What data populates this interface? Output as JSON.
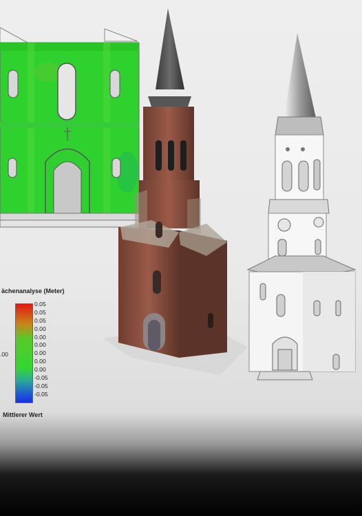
{
  "legend": {
    "title": "ächenanalyse (Meter)",
    "values": [
      "0.05",
      "0.05",
      "0.05",
      "0.00",
      "0.00",
      "0.00",
      "0.00",
      "0.00",
      "0.00",
      "-0.05",
      "-0.05",
      "-0.05"
    ],
    "side_label": ".00",
    "footer": "Mittlerer Wert"
  },
  "colors": {
    "deviation_high": "#e01a12",
    "deviation_zero": "#34d634",
    "deviation_low": "#1a2fe0",
    "brick": "#8a4e3e",
    "roof": "#4a4a4a"
  }
}
